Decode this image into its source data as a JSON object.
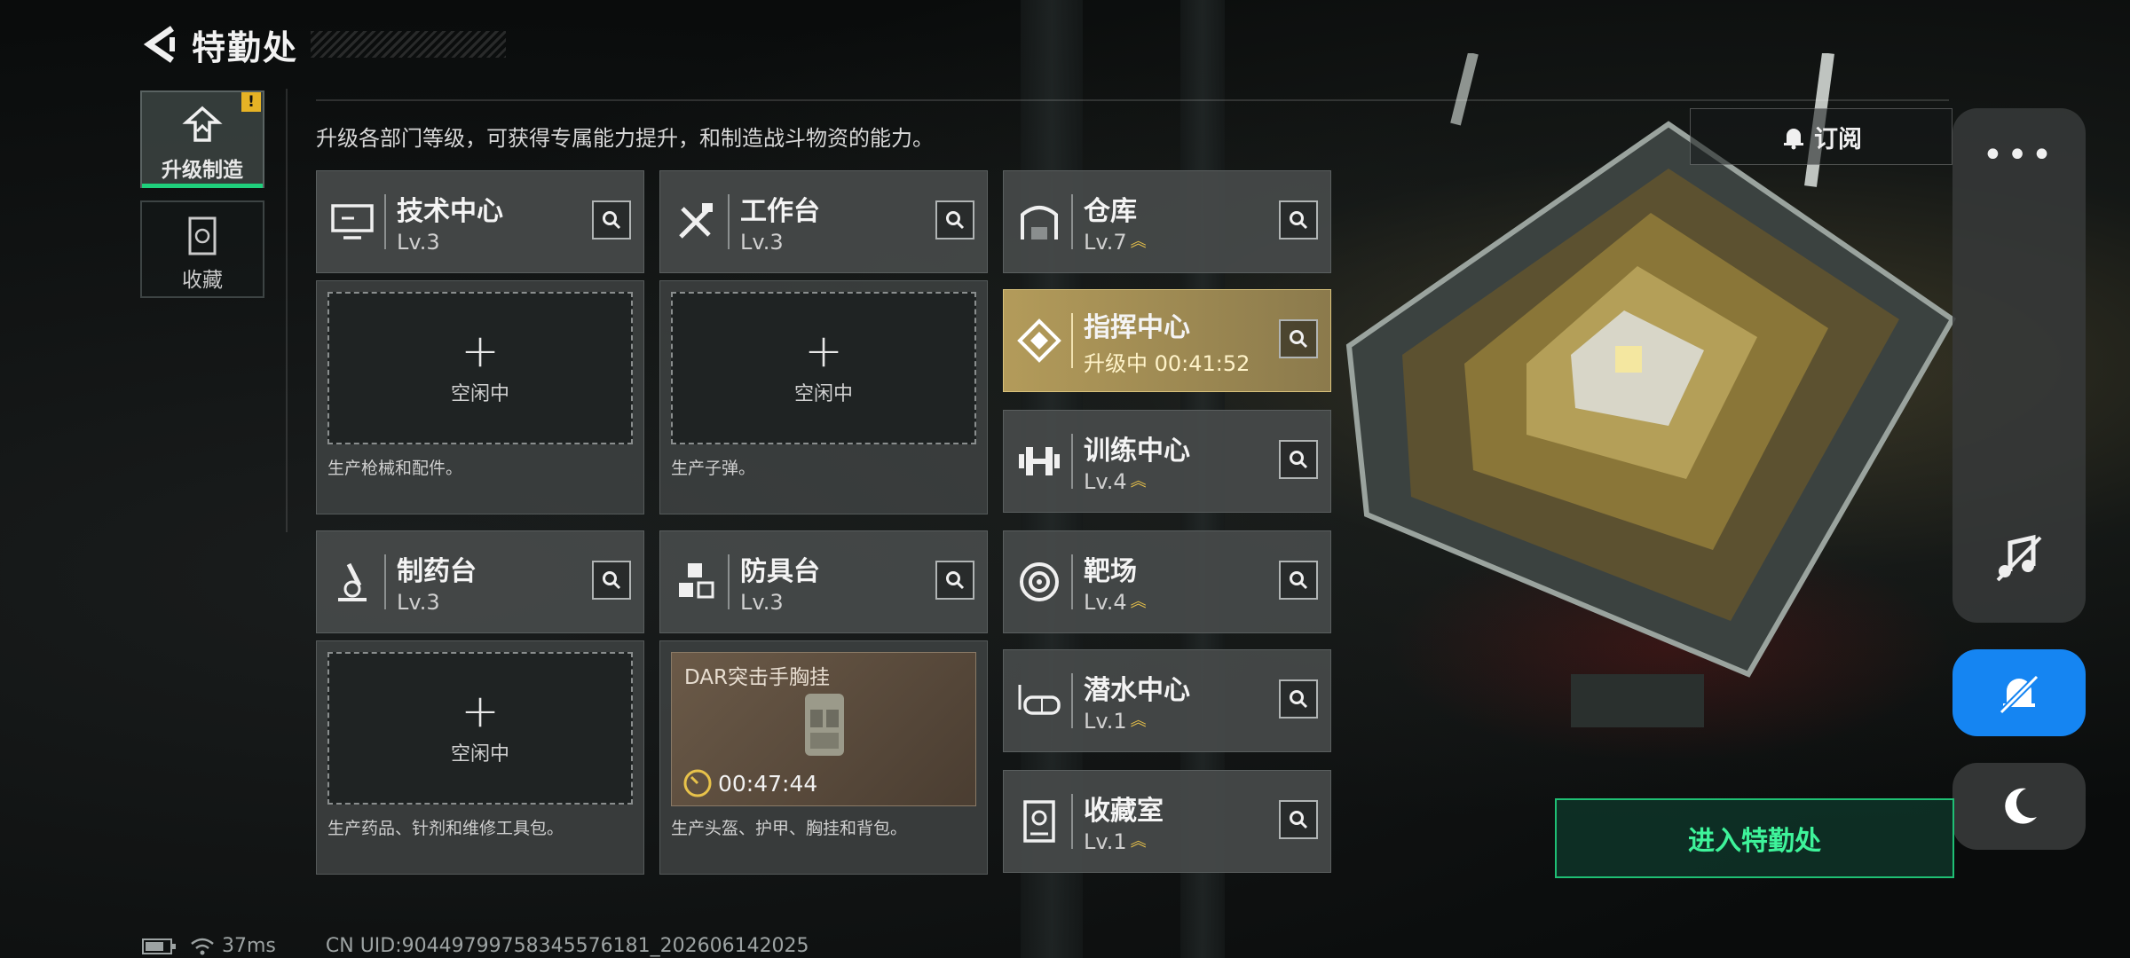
{
  "header": {
    "title": "特勤处"
  },
  "side_tabs": [
    {
      "label": "升级制造",
      "badge": "!"
    },
    {
      "label": "收藏"
    }
  ],
  "description": "升级各部门等级，可获得专属能力提升，和制造战斗物资的能力。",
  "subscribe_label": "订阅",
  "enter_button": "进入特勤处",
  "departments": {
    "tech": {
      "name": "技术中心",
      "level": "Lv.3"
    },
    "workbench": {
      "name": "工作台",
      "level": "Lv.3"
    },
    "warehouse": {
      "name": "仓库",
      "level": "Lv.7"
    },
    "command": {
      "name": "指挥中心",
      "level": "升级中 00:41:52"
    },
    "training": {
      "name": "训练中心",
      "level": "Lv.4"
    },
    "pharmacy": {
      "name": "制药台",
      "level": "Lv.3"
    },
    "armor": {
      "name": "防具台",
      "level": "Lv.3"
    },
    "range": {
      "name": "靶场",
      "level": "Lv.4"
    },
    "diving": {
      "name": "潜水中心",
      "level": "Lv.1"
    },
    "collection": {
      "name": "收藏室",
      "level": "Lv.1"
    }
  },
  "production": {
    "tech": {
      "slot_state": "空闲中",
      "description": "生产枪械和配件。"
    },
    "workbench": {
      "slot_state": "空闲中",
      "description": "生产子弹。"
    },
    "pharmacy": {
      "slot_state": "空闲中",
      "description": "生产药品、针剂和维修工具包。"
    },
    "armor": {
      "item_name": "DAR突击手胸挂",
      "timer": "00:47:44",
      "description": "生产头盔、护甲、胸挂和背包。"
    }
  },
  "status_bar": {
    "ping": "37ms",
    "uid": "CN UID:9044979975834557618​1_202606142025"
  },
  "colors": {
    "accent_green": "#1fcf7c",
    "gold": "#e8c24a",
    "blue_button": "#1585f2"
  }
}
